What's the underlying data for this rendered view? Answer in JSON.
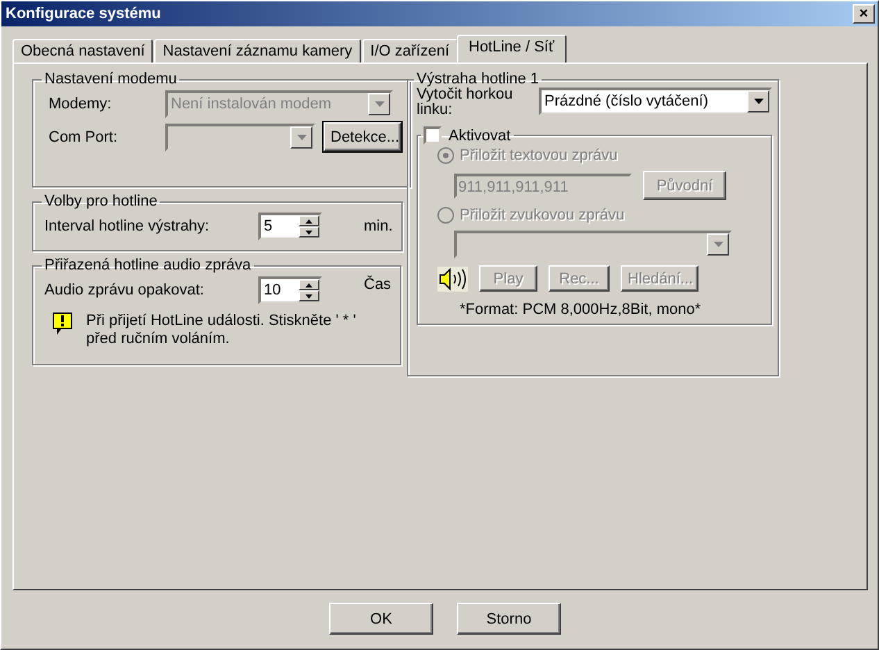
{
  "window": {
    "title": "Konfigurace systému",
    "close": "×"
  },
  "tabs": [
    {
      "label": "Obecná nastavení",
      "selected": false
    },
    {
      "label": "Nastavení záznamu kamery",
      "selected": false
    },
    {
      "label": "I/O zařízení",
      "selected": false
    },
    {
      "label": "HotLine / Síť",
      "selected": true
    }
  ],
  "modem_group": {
    "title": "Nastavení modemu",
    "modem_label": "Modemy:",
    "modem_value": "Není instalován modem",
    "modem_disabled": true,
    "com_port_label": "Com Port:",
    "com_port_disabled": true,
    "detect_button": "Detekce..."
  },
  "hotline_options": {
    "title": "Volby pro hotline",
    "interval_label": "Interval hotline výstrahy:",
    "interval_value": "5",
    "unit": "min."
  },
  "audio_group": {
    "title": "Přiřazená hotline audio zpráva",
    "repeat_label": "Audio zprávu opakovat:",
    "repeat_value": "10",
    "unit": "Čas",
    "note": "Při přijetí HotLine události. Stiskněte ' * ' před ručním voláním."
  },
  "alert_group": {
    "title": "Výstraha hotline 1",
    "dial_label": "Vytočit horkou linku:",
    "dial_value": "Prázdné (číslo vytáčení)",
    "activate": {
      "label": "Aktivovat",
      "checked": false
    },
    "options": [
      {
        "kind": "text",
        "label": "Přiložit textovou zprávu",
        "selected": true,
        "disabled": true,
        "value": "911,911,911,911",
        "button": "Původní"
      },
      {
        "kind": "sound",
        "label": "Přiložit zvukovou zprávu",
        "selected": false,
        "disabled": true,
        "buttons": [
          "Play",
          "Rec...",
          "Hledání..."
        ]
      }
    ],
    "format_note": "*Format: PCM 8,000Hz,8Bit, mono*"
  },
  "buttons": [
    "OK",
    "Storno"
  ]
}
